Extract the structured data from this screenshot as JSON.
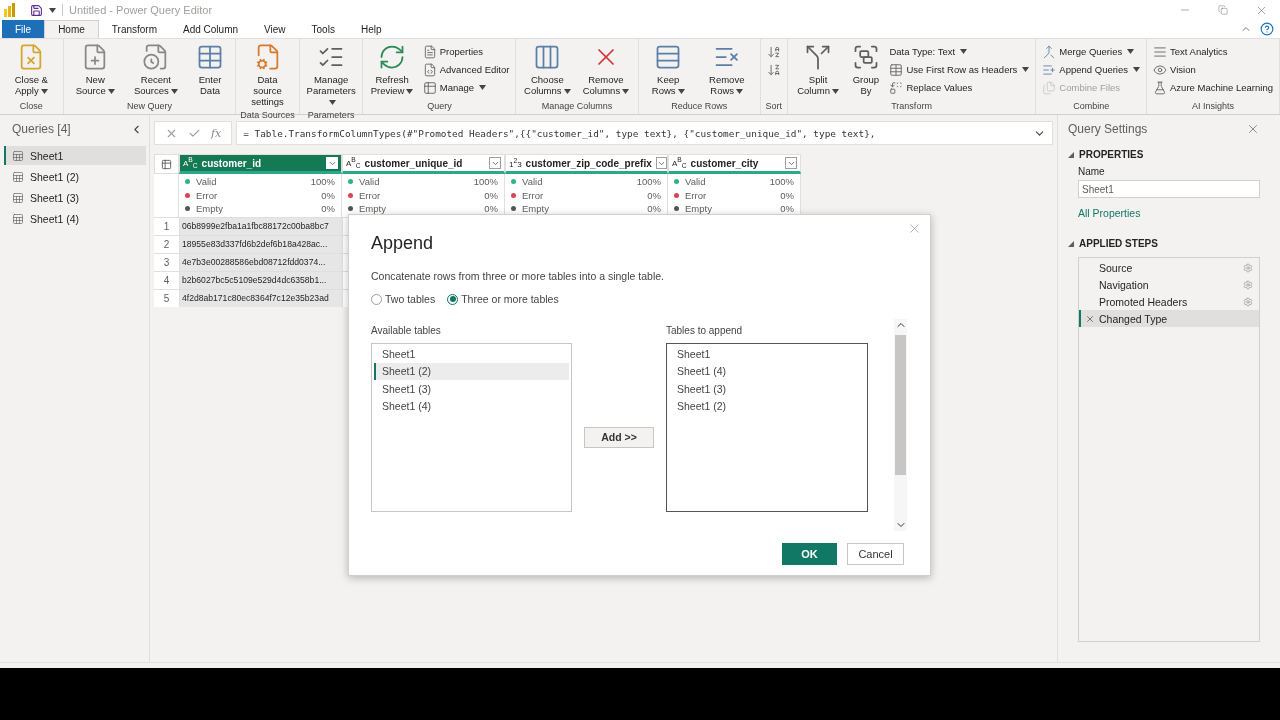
{
  "window": {
    "title": "Untitled - Power Query Editor"
  },
  "tabs": [
    {
      "label": "File",
      "kind": "file",
      "selected": false
    },
    {
      "label": "Home",
      "kind": "tab",
      "selected": true
    },
    {
      "label": "Transform",
      "kind": "tab",
      "selected": false
    },
    {
      "label": "Add Column",
      "kind": "tab",
      "selected": false
    },
    {
      "label": "View",
      "kind": "tab",
      "selected": false
    },
    {
      "label": "Tools",
      "kind": "tab",
      "selected": false
    },
    {
      "label": "Help",
      "kind": "tab",
      "selected": false
    }
  ],
  "ribbon": {
    "groups": [
      {
        "label": "Close",
        "items": [
          {
            "kind": "large",
            "label": "Close & Apply",
            "dropdown": true
          }
        ]
      },
      {
        "label": "New Query",
        "items": [
          {
            "kind": "large",
            "label": "New Source",
            "dropdown": true
          },
          {
            "kind": "large",
            "label": "Recent Sources",
            "dropdown": true
          },
          {
            "kind": "large",
            "label": "Enter Data",
            "dropdown": false
          }
        ]
      },
      {
        "label": "Data Sources",
        "items": [
          {
            "kind": "large",
            "label": "Data source settings",
            "dropdown": false
          }
        ]
      },
      {
        "label": "Parameters",
        "items": [
          {
            "kind": "large",
            "label": "Manage Parameters",
            "dropdown": true
          }
        ]
      },
      {
        "label": "Query",
        "items": [
          {
            "kind": "large",
            "label": "Refresh Preview",
            "dropdown": true
          },
          {
            "kind": "stack",
            "items": [
              {
                "label": "Properties",
                "dropdown": false,
                "disabled": false
              },
              {
                "label": "Advanced Editor",
                "dropdown": false,
                "disabled": false
              },
              {
                "label": "Manage",
                "dropdown": true,
                "disabled": false
              }
            ]
          }
        ]
      },
      {
        "label": "Manage Columns",
        "items": [
          {
            "kind": "large",
            "label": "Choose Columns",
            "dropdown": true
          },
          {
            "kind": "large",
            "label": "Remove Columns",
            "dropdown": true
          }
        ]
      },
      {
        "label": "Reduce Rows",
        "items": [
          {
            "kind": "large",
            "label": "Keep Rows",
            "dropdown": true
          },
          {
            "kind": "large",
            "label": "Remove Rows",
            "dropdown": true
          }
        ]
      },
      {
        "label": "Sort",
        "items": [
          {
            "kind": "stack",
            "items": [
              {
                "dropdown": false,
                "disabled": false
              },
              {
                "dropdown": false,
                "disabled": false
              }
            ]
          }
        ]
      },
      {
        "label": "Transform",
        "items": [
          {
            "kind": "large",
            "label": "Split Column",
            "dropdown": true
          },
          {
            "kind": "large",
            "label": "Group By",
            "dropdown": false
          },
          {
            "kind": "stack",
            "items": [
              {
                "label": "Data Type: Text",
                "dropdown": true,
                "disabled": false
              },
              {
                "label": "Use First Row as Headers",
                "dropdown": true,
                "disabled": false
              },
              {
                "label": "Replace Values",
                "dropdown": false,
                "disabled": false
              }
            ]
          }
        ]
      },
      {
        "label": "Combine",
        "items": [
          {
            "kind": "stack",
            "items": [
              {
                "label": "Merge Queries",
                "dropdown": true,
                "disabled": false
              },
              {
                "label": "Append Queries",
                "dropdown": true,
                "disabled": false
              },
              {
                "label": "Combine Files",
                "dropdown": false,
                "disabled": true
              }
            ]
          }
        ]
      },
      {
        "label": "AI Insights",
        "items": [
          {
            "kind": "stack",
            "items": [
              {
                "label": "Text Analytics",
                "dropdown": false,
                "disabled": false
              },
              {
                "label": "Vision",
                "dropdown": false,
                "disabled": false
              },
              {
                "label": "Azure Machine Learning",
                "dropdown": false,
                "disabled": false
              }
            ]
          }
        ]
      }
    ]
  },
  "queries": {
    "title": "Queries [4]",
    "items": [
      {
        "label": "Sheet1",
        "selected": true
      },
      {
        "label": "Sheet1 (2)",
        "selected": false
      },
      {
        "label": "Sheet1 (3)",
        "selected": false
      },
      {
        "label": "Sheet1 (4)",
        "selected": false
      }
    ]
  },
  "formula_bar": {
    "fx": "fx",
    "formula": "= Table.TransformColumnTypes(#\"Promoted Headers\",{{\"customer_id\", type text}, {\"customer_unique_id\", type text},"
  },
  "table": {
    "columns": [
      {
        "type_label": "A$^{B}$$_{C}$",
        "name": "customer_id",
        "selected": true,
        "quality": [
          {
            "label": "Valid",
            "value": "100%",
            "color": "#2db38b"
          },
          {
            "label": "Error",
            "value": "0%",
            "color": "#d64550"
          },
          {
            "label": "Empty",
            "value": "0%",
            "color": "#555555"
          }
        ]
      },
      {
        "type_label": "A$^{B}$$_{C}$",
        "name": "customer_unique_id",
        "selected": false,
        "quality": [
          {
            "label": "Valid",
            "value": "100%",
            "color": "#2db38b"
          },
          {
            "label": "Error",
            "value": "0%",
            "color": "#d64550"
          },
          {
            "label": "Empty",
            "value": "0%",
            "color": "#555555"
          }
        ]
      },
      {
        "type_label": "1$^{2}$3",
        "name": "customer_zip_code_prefix",
        "selected": false,
        "quality": [
          {
            "label": "Valid",
            "value": "100%",
            "color": "#2db38b"
          },
          {
            "label": "Error",
            "value": "0%",
            "color": "#d64550"
          },
          {
            "label": "Empty",
            "value": "0%",
            "color": "#555555"
          }
        ]
      },
      {
        "type_label": "A$^{B}$$_{C}$",
        "name": "customer_city",
        "selected": false,
        "quality": [
          {
            "label": "Valid",
            "value": "100%",
            "color": "#2db38b"
          },
          {
            "label": "Error",
            "value": "0%",
            "color": "#d64550"
          },
          {
            "label": "Empty",
            "value": "0%",
            "color": "#555555"
          }
        ]
      }
    ],
    "rows": [
      {
        "number": "1",
        "customer_id": "06b8999e2fba1a1fbc88172c00ba8bc7"
      },
      {
        "number": "2",
        "customer_id": "18955e83d337fd6b2def6b18a428ac..."
      },
      {
        "number": "3",
        "customer_id": "4e7b3e00288586ebd08712fdd0374..."
      },
      {
        "number": "4",
        "customer_id": "b2b6027bc5c5109e529d4dc6358b1..."
      },
      {
        "number": "5",
        "customer_id": "4f2d8ab171c80ec8364f7c12e35b23ad"
      }
    ]
  },
  "query_settings": {
    "title": "Query Settings",
    "properties_heading": "PROPERTIES",
    "name_label": "Name",
    "name_value": "Sheet1",
    "all_properties": "All Properties",
    "steps_heading": "APPLIED STEPS",
    "steps": [
      {
        "label": "Source",
        "selected": false
      },
      {
        "label": "Navigation",
        "selected": false
      },
      {
        "label": "Promoted Headers",
        "selected": false
      },
      {
        "label": "Changed Type",
        "selected": true
      }
    ]
  },
  "dialog": {
    "title": "Append",
    "description": "Concatenate rows from three or more tables into a single table.",
    "options": [
      {
        "label": "Two tables",
        "selected": false
      },
      {
        "label": "Three or more tables",
        "selected": true
      }
    ],
    "available_label": "Available tables",
    "available": [
      {
        "label": "Sheet1",
        "selected": false
      },
      {
        "label": "Sheet1 (2)",
        "selected": true
      },
      {
        "label": "Sheet1 (3)",
        "selected": false
      },
      {
        "label": "Sheet1 (4)",
        "selected": false
      }
    ],
    "add_button": "Add >>",
    "append_label": "Tables to append",
    "to_append": [
      {
        "label": "Sheet1",
        "selected": false
      },
      {
        "label": "Sheet1 (4)",
        "selected": false
      },
      {
        "label": "Sheet1 (3)",
        "selected": false
      },
      {
        "label": "Sheet1 (2)",
        "selected": false
      }
    ],
    "ok": "OK",
    "cancel": "Cancel"
  }
}
